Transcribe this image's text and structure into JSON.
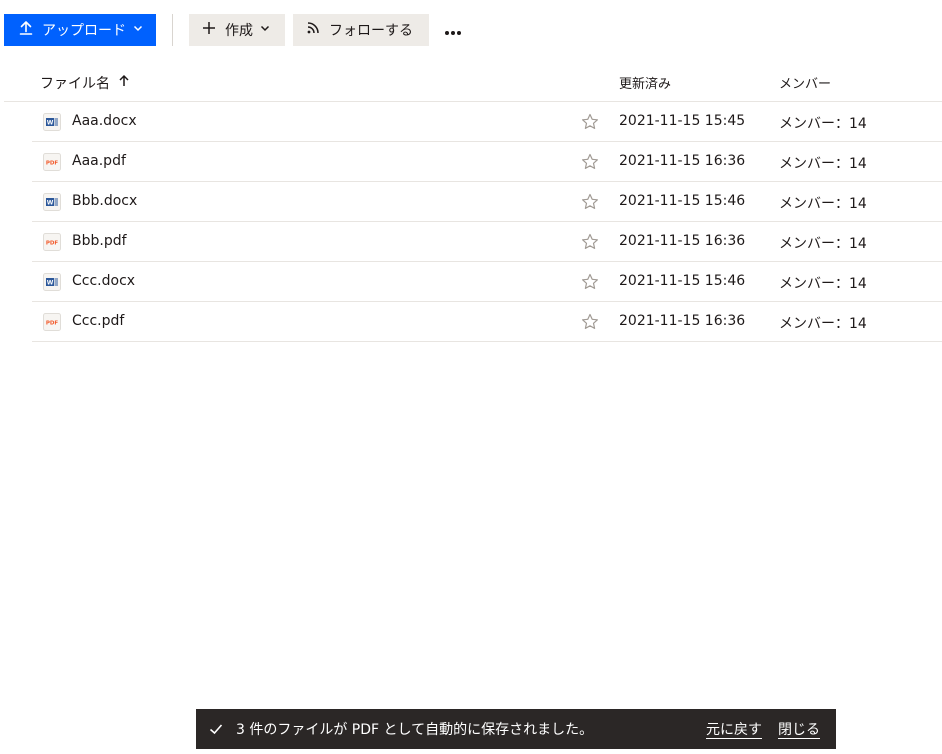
{
  "toolbar": {
    "upload_label": "アップロード",
    "create_label": "作成",
    "follow_label": "フォローする",
    "upload_icon": "upload-icon",
    "create_icon": "plus-icon",
    "follow_icon": "rss-icon",
    "more_icon": "more-icon"
  },
  "table": {
    "headers": {
      "name": "ファイル名",
      "modified": "更新済み",
      "members": "メンバー"
    },
    "rows": [
      {
        "name": "Aaa.docx",
        "type": "word",
        "modified": "2021-11-15 15:45",
        "members": "メンバー：14"
      },
      {
        "name": "Aaa.pdf",
        "type": "pdf",
        "modified": "2021-11-15 16:36",
        "members": "メンバー：14"
      },
      {
        "name": "Bbb.docx",
        "type": "word",
        "modified": "2021-11-15 15:46",
        "members": "メンバー：14"
      },
      {
        "name": "Bbb.pdf",
        "type": "pdf",
        "modified": "2021-11-15 16:36",
        "members": "メンバー：14"
      },
      {
        "name": "Ccc.docx",
        "type": "word",
        "modified": "2021-11-15 15:46",
        "members": "メンバー：14"
      },
      {
        "name": "Ccc.pdf",
        "type": "pdf",
        "modified": "2021-11-15 16:36",
        "members": "メンバー：14"
      }
    ]
  },
  "snackbar": {
    "message": "3 件のファイルが PDF として自動的に保存されました。",
    "undo_label": "元に戻す",
    "close_label": "閉じる"
  },
  "colors": {
    "primary": "#0061fe",
    "button_gray": "#eeebe7",
    "pdf_red": "#f25a2b",
    "word_blue": "#2b579a",
    "snackbar_bg": "#2b2726"
  }
}
